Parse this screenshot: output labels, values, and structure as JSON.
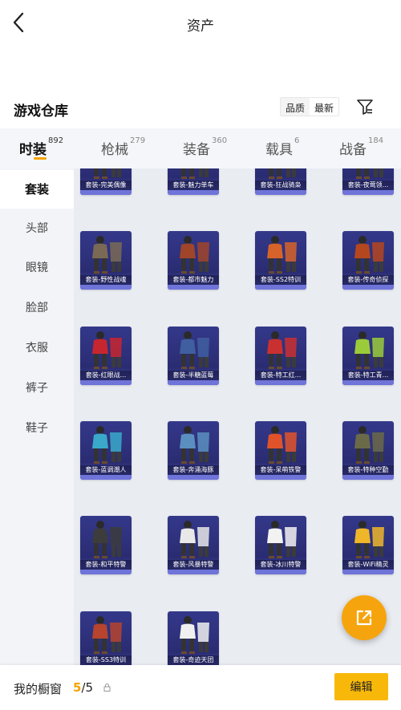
{
  "header": {
    "title": "资产"
  },
  "section": {
    "title": "游戏仓库",
    "sort_options": [
      "品质",
      "最新"
    ],
    "sort_active": 0
  },
  "tabs": [
    {
      "label": "时装",
      "count": "892",
      "active": true
    },
    {
      "label": "枪械",
      "count": "279",
      "active": false
    },
    {
      "label": "装备",
      "count": "360",
      "active": false
    },
    {
      "label": "载具",
      "count": "6",
      "active": false
    },
    {
      "label": "战备",
      "count": "184",
      "active": false
    }
  ],
  "sidebar": {
    "items": [
      {
        "label": "套装",
        "active": true
      },
      {
        "label": "头部",
        "active": false
      },
      {
        "label": "眼镜",
        "active": false
      },
      {
        "label": "脸部",
        "active": false
      },
      {
        "label": "衣服",
        "active": false
      },
      {
        "label": "裤子",
        "active": false
      },
      {
        "label": "鞋子",
        "active": false
      }
    ]
  },
  "items": [
    {
      "name": "套装-完美偶像",
      "accent": "#d9d9d9"
    },
    {
      "name": "套装-魅力单车",
      "accent": "#8c8c8c"
    },
    {
      "name": "套装-狂战骑枭",
      "accent": "#b03a3a"
    },
    {
      "name": "套装-夜莺领...",
      "accent": "#555555"
    },
    {
      "name": "套装-野性战魂",
      "accent": "#7a6a55"
    },
    {
      "name": "套装-都市魅力",
      "accent": "#a0452a"
    },
    {
      "name": "套装-SS2特训",
      "accent": "#d6632a"
    },
    {
      "name": "套装-传奇侦探",
      "accent": "#b5471f"
    },
    {
      "name": "套装-红眼战...",
      "accent": "#c8262f"
    },
    {
      "name": "套装-半糖蓝莓",
      "accent": "#3f5fa0"
    },
    {
      "name": "套装-特工红...",
      "accent": "#c93030"
    },
    {
      "name": "套装-特工青...",
      "accent": "#9acc3a"
    },
    {
      "name": "套装-蓝调潮人",
      "accent": "#3aa9c9"
    },
    {
      "name": "套装-奔涌海豚",
      "accent": "#5a8fc0"
    },
    {
      "name": "套装-呆萌铁警",
      "accent": "#e0532a"
    },
    {
      "name": "套装-特种空勤",
      "accent": "#6b6a48"
    },
    {
      "name": "套装-和平特警",
      "accent": "#3c3c3c"
    },
    {
      "name": "套装-风暴特警",
      "accent": "#e8e8e8"
    },
    {
      "name": "套装-冰川特警",
      "accent": "#f2f2f2"
    },
    {
      "name": "套装-WiFi精灵",
      "accent": "#f0b62a"
    },
    {
      "name": "套装-SS3特训",
      "accent": "#b6442e"
    },
    {
      "name": "套装-奇迹天团",
      "accent": "#f0f0f0"
    }
  ],
  "showcase": {
    "label": "我的橱窗",
    "used": "5",
    "separator": "/",
    "total": "5"
  },
  "edit_label": "编辑",
  "colors": {
    "accent": "#f5a300",
    "edit_button": "#f8b80a",
    "card_bg": "#2f3280"
  }
}
